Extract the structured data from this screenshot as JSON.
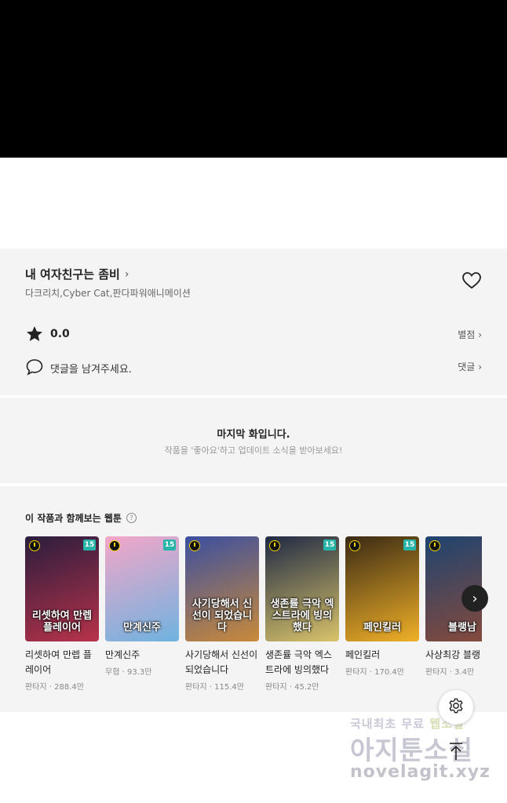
{
  "work": {
    "title": "내 여자친구는 좀비",
    "authors": "다크리치,Cyber Cat,판다파워애니메이션",
    "rating": "0.0",
    "rating_link": "별점",
    "comment_prompt": "댓글을 남겨주세요.",
    "comment_link": "댓글"
  },
  "end_notice": {
    "title": "마지막 화입니다.",
    "subtitle": "작품을 '좋아요'하고 업데이트 소식을 받아보세요!"
  },
  "recommendations": {
    "heading": "이 작품과 함께보는 웹툰",
    "items": [
      {
        "title": "리셋하여 만렙 플레이어",
        "genre": "판타지",
        "views": "288.4만",
        "age": "15",
        "cover_text": "리셋하여 만렙 플레이어",
        "color1": "#2a1d3d",
        "color2": "#b8324a"
      },
      {
        "title": "만계신주",
        "genre": "무협",
        "views": "93.3만",
        "age": "15",
        "cover_text": "만계신주",
        "color1": "#f3a6c8",
        "color2": "#6fb3e0"
      },
      {
        "title": "사기당해서 신선이 되었습니다",
        "genre": "판타지",
        "views": "115.4만",
        "age": "",
        "cover_text": "사기당해서 신선이 되었습니다",
        "color1": "#3b4fa0",
        "color2": "#c98a3a"
      },
      {
        "title": "생존률 극악 엑스트라에 빙의했다",
        "genre": "판타지",
        "views": "45.2만",
        "age": "15",
        "cover_text": "생존률 극악 엑스트라에 빙의했다",
        "color1": "#1f2a44",
        "color2": "#d9c36a"
      },
      {
        "title": "페인킬러",
        "genre": "판타지",
        "views": "170.4만",
        "age": "15",
        "cover_text": "페인킬러",
        "color1": "#3a2a14",
        "color2": "#f0b028"
      },
      {
        "title": "사상최강 블랭",
        "genre": "판타지",
        "views": "3.4만",
        "age": "",
        "cover_text": "블랭남",
        "color1": "#1e4470",
        "color2": "#8a4a3a"
      }
    ]
  },
  "watermark": {
    "line1": "국내최초 무료",
    "line1_highlight": "웹소설",
    "line2": "아지툰소설",
    "line3": "novelagit.xyz"
  },
  "icons": {
    "heart": "heart-icon",
    "star": "star-icon",
    "comment": "comment-icon",
    "settings": "gear-icon",
    "scroll_top": "arrow-up-icon",
    "next": "chevron-right-icon"
  }
}
